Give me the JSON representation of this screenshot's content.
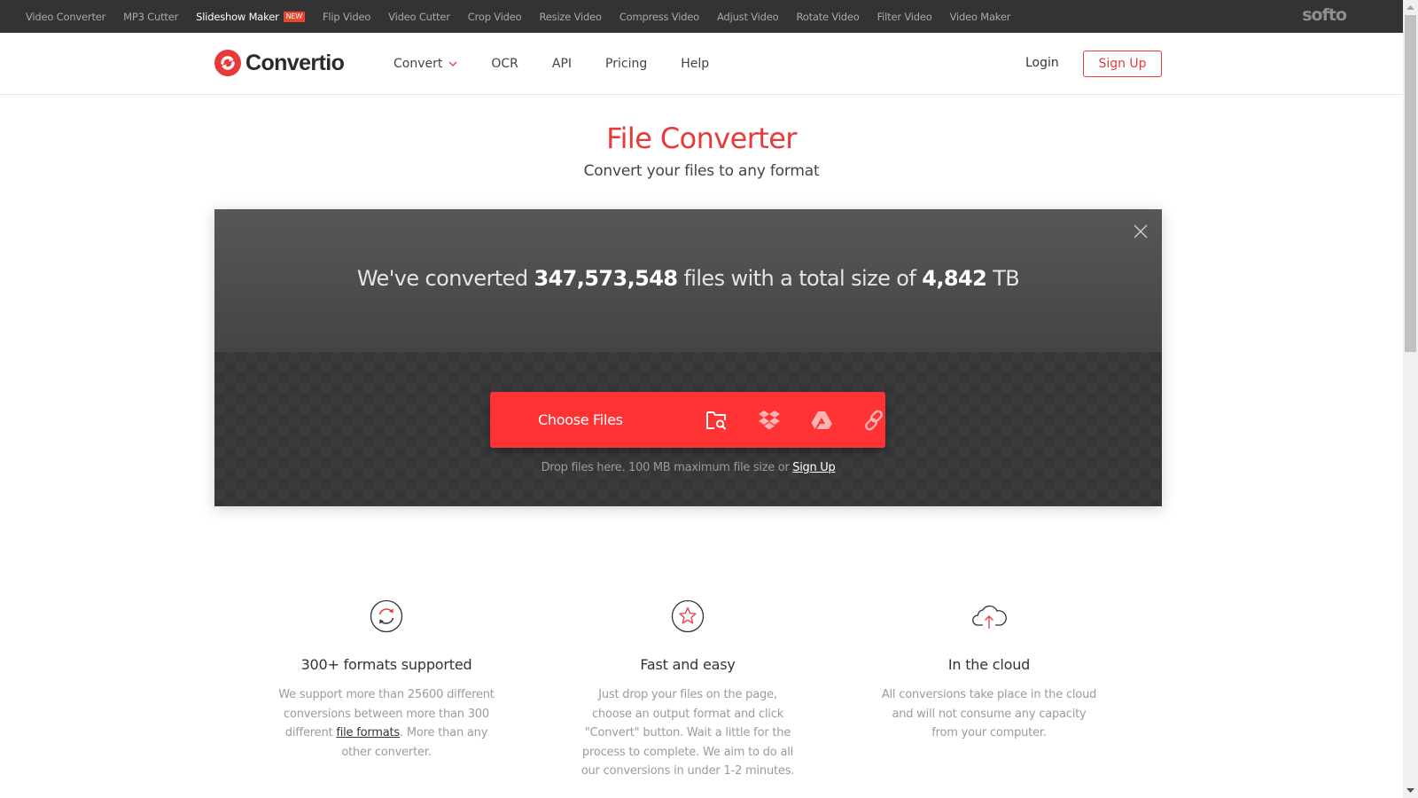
{
  "softo_bar": {
    "items": [
      {
        "label": "Video Converter",
        "active": false
      },
      {
        "label": "MP3 Cutter",
        "active": false
      },
      {
        "label": "Slideshow Maker",
        "active": true,
        "badge": "NEW"
      },
      {
        "label": "Flip Video",
        "active": false
      },
      {
        "label": "Video Cutter",
        "active": false
      },
      {
        "label": "Crop Video",
        "active": false
      },
      {
        "label": "Resize Video",
        "active": false
      },
      {
        "label": "Compress Video",
        "active": false
      },
      {
        "label": "Adjust Video",
        "active": false
      },
      {
        "label": "Rotate Video",
        "active": false
      },
      {
        "label": "Filter Video",
        "active": false
      },
      {
        "label": "Video Maker",
        "active": false
      }
    ],
    "brand": "softo"
  },
  "header": {
    "logo_text": "Convertio",
    "nav": [
      {
        "label": "Convert",
        "has_dropdown": true
      },
      {
        "label": "OCR"
      },
      {
        "label": "API"
      },
      {
        "label": "Pricing"
      },
      {
        "label": "Help"
      }
    ],
    "login_label": "Login",
    "signup_label": "Sign Up"
  },
  "hero": {
    "title": "File Converter",
    "subtitle": "Convert your files to any format"
  },
  "upload": {
    "stats_prefix": "We've converted ",
    "files_count": "347,573,548",
    "stats_middle": " files with a total size of ",
    "total_size": "4,842",
    "stats_suffix": " TB",
    "choose_label": "Choose Files",
    "sources": [
      "folder-search-icon",
      "dropbox-icon",
      "google-drive-icon",
      "link-icon"
    ],
    "drop_hint": "Drop files here. 100 MB maximum file size or ",
    "drop_hint_link": "Sign Up"
  },
  "features": [
    {
      "icon": "refresh-icon",
      "title": "300+ formats supported",
      "text_before": "We support more than 25600 different conversions between more than 300 different ",
      "link": "file formats",
      "text_after": ". More than any other converter."
    },
    {
      "icon": "star-icon",
      "title": "Fast and easy",
      "text_before": "Just drop your files on the page, choose an output format and click \"Convert\" button. Wait a little for the process to complete. We aim to do all our conversions in under 1-2 minutes."
    },
    {
      "icon": "cloud-upload-icon",
      "title": "In the cloud",
      "text_before": "All conversions take place in the cloud and will not consume any capacity from your computer."
    }
  ],
  "colors": {
    "accent": "#e83a3a",
    "button": "#ff3333",
    "topbar": "#333333"
  }
}
